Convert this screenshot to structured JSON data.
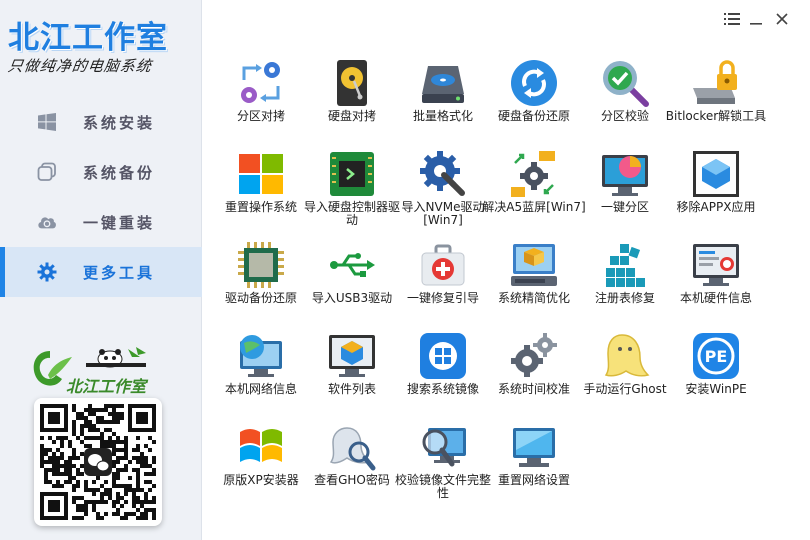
{
  "brand": {
    "title": "北江工作室",
    "subtitle": "只做纯净的电脑系统",
    "logo_text": "北江工作室"
  },
  "sidebar": {
    "items": [
      {
        "label": "系统安装",
        "icon": "windows-icon"
      },
      {
        "label": "系统备份",
        "icon": "copy-icon"
      },
      {
        "label": "一键重装",
        "icon": "cloud-refresh-icon"
      },
      {
        "label": "更多工具",
        "icon": "gear-icon",
        "active": true
      }
    ]
  },
  "window": {
    "controls": [
      "menu-icon",
      "minimize-icon",
      "close-icon"
    ]
  },
  "tools": [
    {
      "label": "分区对拷",
      "icon": "partition-copy-icon"
    },
    {
      "label": "硬盘对拷",
      "icon": "disk-copy-icon"
    },
    {
      "label": "批量格式化",
      "icon": "batch-format-icon"
    },
    {
      "label": "硬盘备份还原",
      "icon": "disk-backup-icon"
    },
    {
      "label": "分区校验",
      "icon": "partition-check-icon"
    },
    {
      "label": "Bitlocker解锁工具",
      "icon": "bitlocker-icon"
    },
    {
      "label": "重置操作系统",
      "icon": "windows-reset-icon"
    },
    {
      "label": "导入硬盘控制器驱动",
      "icon": "controller-driver-icon"
    },
    {
      "label": "导入NVMe驱动[Win7]",
      "icon": "nvme-gear-icon"
    },
    {
      "label": "解决A5蓝屏[Win7]",
      "icon": "a5-fix-icon"
    },
    {
      "label": "一键分区",
      "icon": "one-key-partition-icon"
    },
    {
      "label": "移除APPX应用",
      "icon": "appx-remove-icon"
    },
    {
      "label": "驱动备份还原",
      "icon": "chip-icon"
    },
    {
      "label": "导入USB3驱动",
      "icon": "usb-icon"
    },
    {
      "label": "一键修复引导",
      "icon": "first-aid-icon"
    },
    {
      "label": "系统精简优化",
      "icon": "system-optimize-icon"
    },
    {
      "label": "注册表修复",
      "icon": "registry-icon"
    },
    {
      "label": "本机硬件信息",
      "icon": "hardware-info-icon"
    },
    {
      "label": "本机网络信息",
      "icon": "network-globe-icon"
    },
    {
      "label": "软件列表",
      "icon": "software-list-icon"
    },
    {
      "label": "搜索系统镜像",
      "icon": "search-image-icon"
    },
    {
      "label": "系统时间校准",
      "icon": "time-gears-icon"
    },
    {
      "label": "手动运行Ghost",
      "icon": "ghost-icon"
    },
    {
      "label": "安装WinPE",
      "icon": "pe-icon"
    },
    {
      "label": "原版XP安装器",
      "icon": "xp-icon"
    },
    {
      "label": "查看GHO密码",
      "icon": "gho-password-icon"
    },
    {
      "label": "校验镜像文件完整性",
      "icon": "verify-image-icon"
    },
    {
      "label": "重置网络设置",
      "icon": "network-reset-icon"
    }
  ]
}
